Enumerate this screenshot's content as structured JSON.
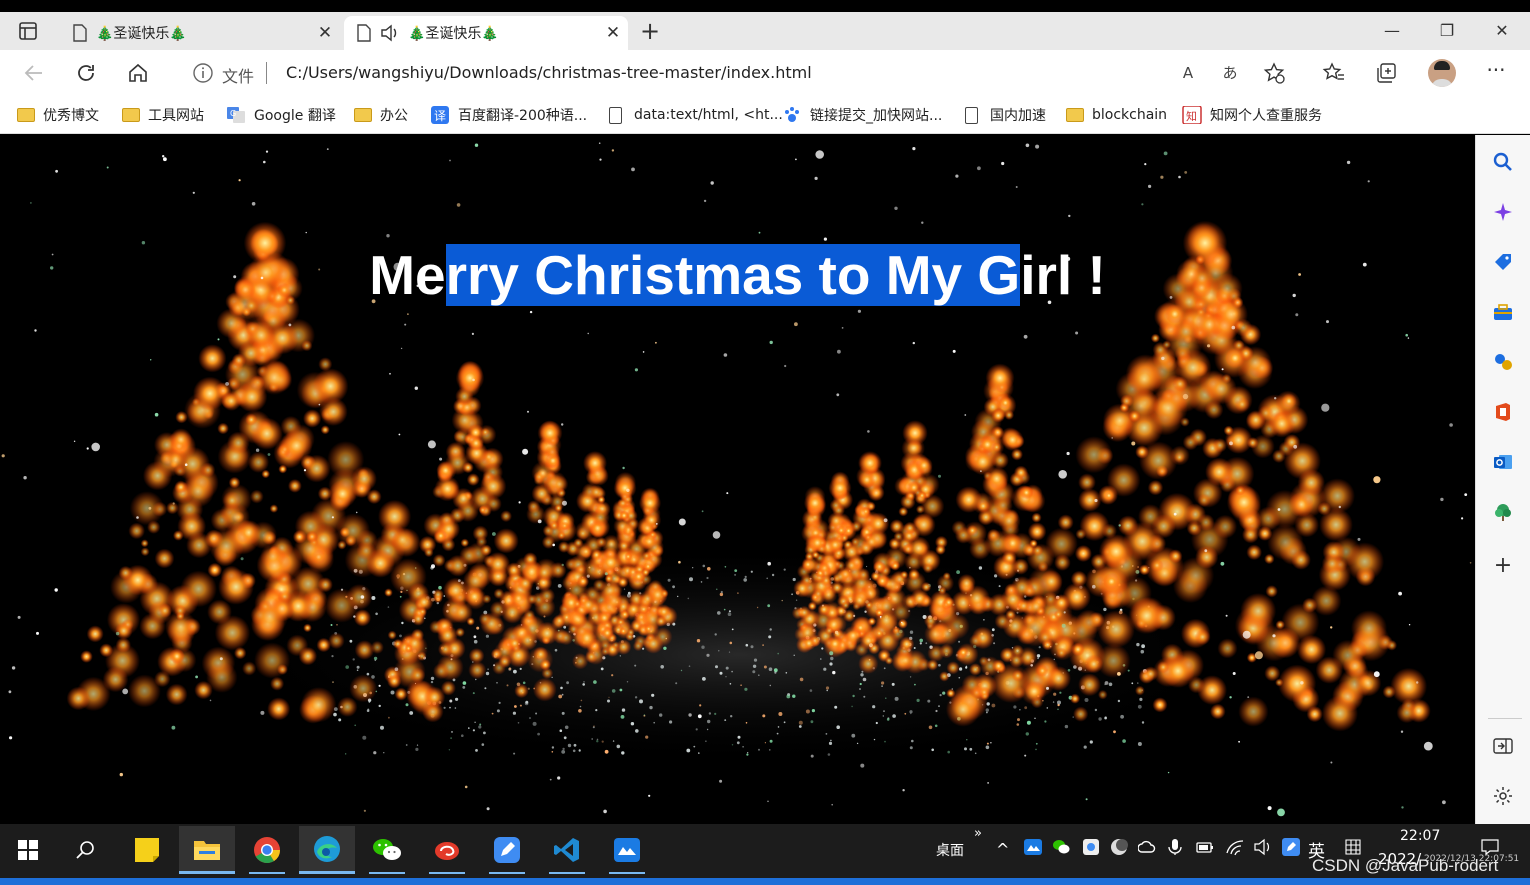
{
  "tabs": [
    {
      "title": "🎄圣诞快乐🎄",
      "close": "✕"
    },
    {
      "title": "🎄圣诞快乐🎄",
      "close": "✕"
    }
  ],
  "newtab_symbol": "+",
  "window_controls": {
    "minimize": "—",
    "restore": "❐",
    "close": "✕"
  },
  "address": {
    "file_label": "文件",
    "url": "C:/Users/wangshiyu/Downloads/christmas-tree-master/index.html"
  },
  "nav_right": {
    "read_aloud": "A",
    "translate": "あ"
  },
  "more_symbol": "···",
  "bookmarks": [
    {
      "label": "优秀博文",
      "icon": "folder-icon"
    },
    {
      "label": "工具网站",
      "icon": "folder-icon"
    },
    {
      "label": "Google 翻译",
      "icon": "google-translate-icon"
    },
    {
      "label": "办公",
      "icon": "folder-icon"
    },
    {
      "label": "百度翻译-200种语...",
      "icon": "baidu-translate-icon"
    },
    {
      "label": "data:text/html, <ht...",
      "icon": "page-icon"
    },
    {
      "label": "链接提交_加快网站...",
      "icon": "baidu-paw-icon"
    },
    {
      "label": "国内加速",
      "icon": "page-icon"
    },
    {
      "label": "blockchain",
      "icon": "folder-icon"
    },
    {
      "label": "知网个人查重服务",
      "icon": "cnki-icon"
    }
  ],
  "headline": {
    "before": "Me",
    "selected": "rry Christmas to My G",
    "after": "irl !"
  },
  "taskbar": {
    "desktop_label": "桌面",
    "chevron": "»",
    "up_arrow": "^",
    "ime": "英",
    "time": "22:07",
    "date": "2022/",
    "date_small": "2022/12/13 22:07:51"
  },
  "watermark": "CSDN @JavaPub-rodert",
  "colors": {
    "selection": "#0a5bd6",
    "taskbar": "#1c1c1c",
    "tree_glow": "#ff7a18"
  }
}
